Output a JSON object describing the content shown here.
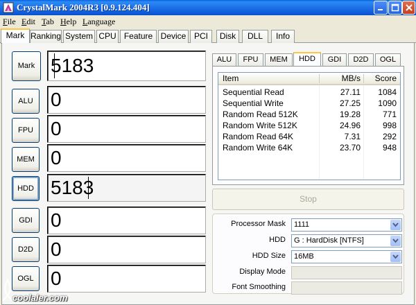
{
  "window": {
    "title": "CrystalMark 2004R3 [0.9.124.404]"
  },
  "menu": [
    "File",
    "Edit",
    "Tab",
    "Help",
    "Language"
  ],
  "main_tabs": [
    "Mark",
    "Ranking",
    "System",
    "CPU",
    "Feature",
    "Device",
    "PCI",
    "Disk",
    "DLL",
    "Info"
  ],
  "active_main_tab": "Mark",
  "benchmarks": [
    {
      "label": "Mark",
      "score": "5183"
    },
    {
      "label": "ALU",
      "score": "0"
    },
    {
      "label": "FPU",
      "score": "0"
    },
    {
      "label": "MEM",
      "score": "0"
    },
    {
      "label": "HDD",
      "score": "5183"
    },
    {
      "label": "GDI",
      "score": "0"
    },
    {
      "label": "D2D",
      "score": "0"
    },
    {
      "label": "OGL",
      "score": "0"
    }
  ],
  "sub_tabs": [
    "ALU",
    "FPU",
    "MEM",
    "HDD",
    "GDI",
    "D2D",
    "OGL"
  ],
  "active_sub_tab": "HDD",
  "results": {
    "columns": [
      "Item",
      "MB/s",
      "Score"
    ],
    "rows": [
      [
        "Sequential Read",
        "27.11",
        "1084"
      ],
      [
        "Sequential Write",
        "27.25",
        "1090"
      ],
      [
        "Random Read 512K",
        "19.28",
        "771"
      ],
      [
        "Random Write 512K",
        "24.96",
        "998"
      ],
      [
        "Random Read 64K",
        "7.31",
        "292"
      ],
      [
        "Random Write 64K",
        "23.70",
        "948"
      ]
    ]
  },
  "stop_label": "Stop",
  "settings": {
    "processor_mask": {
      "label": "Processor Mask",
      "value": "1111"
    },
    "hdd": {
      "label": "HDD",
      "value": "G : HardDisk [NTFS]"
    },
    "hdd_size": {
      "label": "HDD Size",
      "value": "16MB"
    },
    "display_mode": {
      "label": "Display Mode",
      "value": ""
    },
    "font_smoothing": {
      "label": "Font Smoothing",
      "value": ""
    }
  },
  "watermark": "coolaler.com",
  "colors": {
    "titlebar": "#0a5fdd",
    "tab_highlight": "#ffc83c",
    "face": "#ece9d8"
  }
}
